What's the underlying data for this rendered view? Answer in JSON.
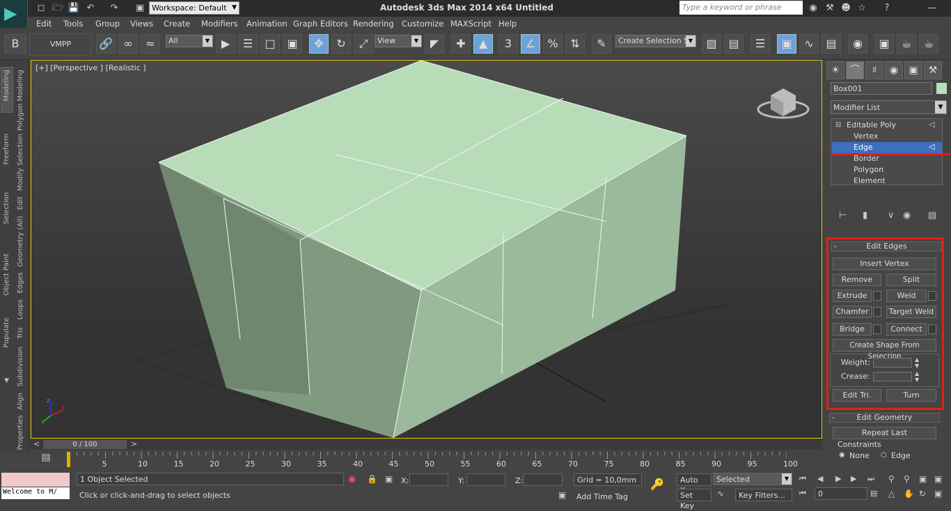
{
  "title_bar": {
    "workspace": "Workspace: Default",
    "app_title": "Autodesk 3ds Max  2014 x64      Untitled",
    "search_placeholder": "Type a keyword or phrase"
  },
  "menu": [
    "Edit",
    "Tools",
    "Group",
    "Views",
    "Create",
    "Modifiers",
    "Animation",
    "Graph Editors",
    "Rendering",
    "Customize",
    "MAXScript",
    "Help"
  ],
  "toolbar": {
    "vmpp": "VMPP",
    "filter": "All",
    "ref_coord": "View",
    "snap_3": "3",
    "selection_set": "Create Selection Se"
  },
  "ribbon_tabs": [
    "Modeling",
    "Freeform",
    "Selection",
    "Object Paint",
    "Populate"
  ],
  "ribbon_subtabs": [
    "Polygon Modeling",
    "Modify Selection",
    "Edit",
    "Geometry (All)",
    "Edges",
    "Loops",
    "Tris",
    "Subdivision",
    "Align",
    "Properties"
  ],
  "viewport": {
    "label": "[+] [Perspective ] [Realistic ]",
    "axis_x": "x",
    "axis_y": "y",
    "axis_z": "z"
  },
  "time_slider": {
    "value": "0 / 100"
  },
  "timeline_ticks": [
    "5",
    "10",
    "15",
    "20",
    "25",
    "30",
    "35",
    "40",
    "45",
    "50",
    "55",
    "60",
    "65",
    "70",
    "75",
    "80",
    "85",
    "90",
    "95",
    "100"
  ],
  "command_panel": {
    "object_name": "Box001",
    "object_color": "#b8e0bb",
    "modifier_list": "Modifier List",
    "stack": [
      "Editable Poly",
      "Vertex",
      "Edge",
      "Border",
      "Polygon",
      "Element"
    ],
    "selected_stack_index": 2
  },
  "edit_edges": {
    "title": "Edit Edges",
    "insert_vertex": "Insert Vertex",
    "remove": "Remove",
    "split": "Split",
    "extrude": "Extrude",
    "weld": "Weld",
    "chamfer": "Chamfer",
    "target_weld": "Target Weld",
    "bridge": "Bridge",
    "connect": "Connect",
    "create_shape": "Create Shape From Selection",
    "weight_label": "Weight:",
    "crease_label": "Crease:",
    "edit_tri": "Edit Tri.",
    "turn": "Turn"
  },
  "edit_geometry": {
    "title": "Edit Geometry",
    "repeat_last": "Repeat Last",
    "constraints_label": "Constraints",
    "none": "None",
    "edge": "Edge"
  },
  "status": {
    "maxscript": "Welcome to M/",
    "selected_count": "1 Object Selected",
    "hint": "Click or click-and-drag to select objects",
    "x_label": "X:",
    "y_label": "Y:",
    "z_label": "Z:",
    "grid": "Grid = 10,0mm",
    "auto_key": "Auto Key",
    "key_mode": "Selected",
    "set_key": "Set Key",
    "key_filters": "Key Filters...",
    "add_time_tag": "Add Time Tag",
    "frame": "0"
  },
  "colors": {
    "accent_red": "#e0201a",
    "selection_blue": "#3e6ebf",
    "box_top": "#b8dcb8",
    "box_side": "#8ea88e",
    "viewport_border": "#e7c600"
  }
}
